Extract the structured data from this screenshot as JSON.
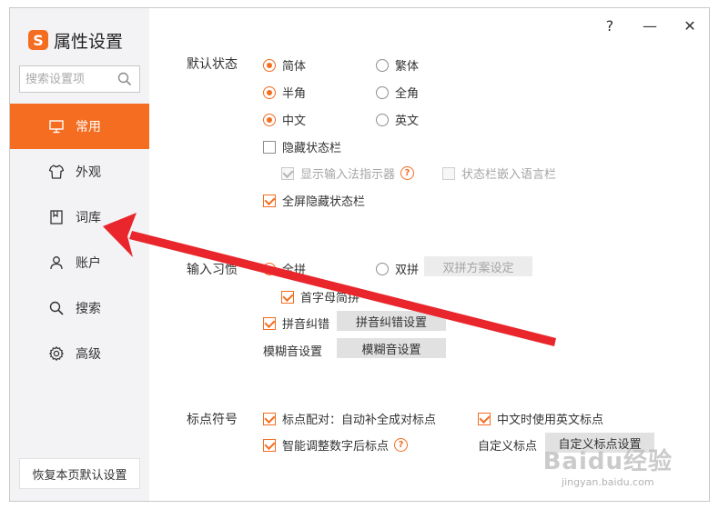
{
  "app": {
    "title": "属性设置",
    "logo": "S"
  },
  "titlebar": {
    "help": "?",
    "minimize": "—",
    "close": "✕"
  },
  "search": {
    "placeholder": "搜索设置项"
  },
  "nav": [
    {
      "label": "常用",
      "icon": "monitor-icon",
      "active": true
    },
    {
      "label": "外观",
      "icon": "shirt-icon",
      "active": false
    },
    {
      "label": "词库",
      "icon": "book-icon",
      "active": false
    },
    {
      "label": "账户",
      "icon": "user-icon",
      "active": false
    },
    {
      "label": "搜索",
      "icon": "search-icon",
      "active": false
    },
    {
      "label": "高级",
      "icon": "gear-icon",
      "active": false
    }
  ],
  "restore_button": "恢复本页默认设置",
  "default_state": {
    "label": "默认状态",
    "simplified": "简体",
    "traditional": "繁体",
    "half_width": "半角",
    "full_width": "全角",
    "chinese": "中文",
    "english": "英文",
    "hide_statusbar": "隐藏状态栏",
    "show_indicator": "显示输入法指示器",
    "embed_langbar": "状态栏嵌入语言栏",
    "fullscreen_hide": "全屏隐藏状态栏"
  },
  "input_habit": {
    "label": "输入习惯",
    "quanpin": "全拼",
    "shuangpin": "双拼",
    "shuangpin_btn": "双拼方案设定",
    "initials": "首字母简拼",
    "correction": "拼音纠错",
    "correction_btn": "拼音纠错设置",
    "fuzzy_label": "模糊音设置",
    "fuzzy_btn": "模糊音设置"
  },
  "punctuation": {
    "label": "标点符号",
    "pairing": "标点配对：自动补全成对标点",
    "english_punct": "中文时使用英文标点",
    "smart_adjust": "智能调整数字后标点",
    "custom_label": "自定义标点",
    "custom_btn": "自定义标点设置"
  },
  "watermark": {
    "main": "Baidu经验",
    "sub": "jingyan.baidu.com"
  },
  "colors": {
    "accent": "#f46d21",
    "arrow": "#e8262b"
  }
}
